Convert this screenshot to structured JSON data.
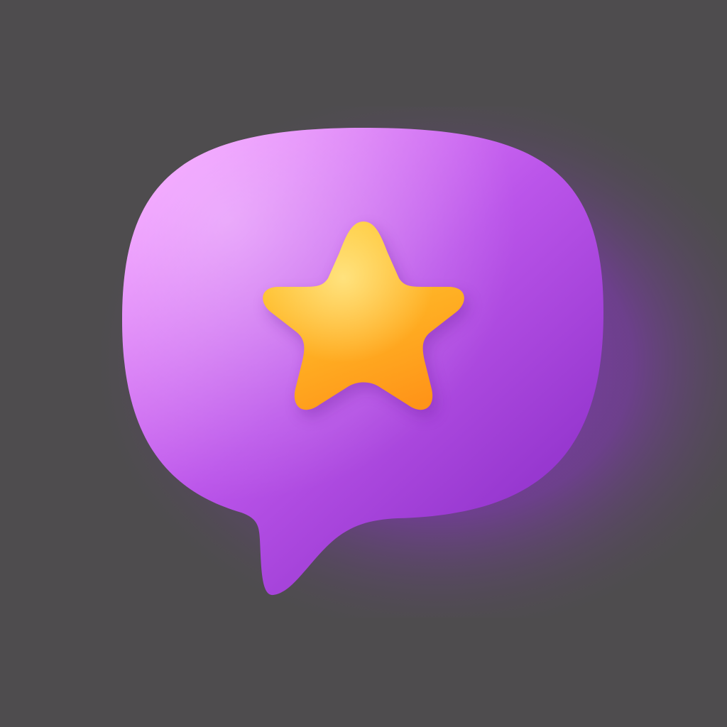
{
  "icon": {
    "name": "speech-bubble-star-icon",
    "bubble_color_light": "#ec88ff",
    "bubble_color_mid": "#b04ee6",
    "bubble_color_dark": "#8a2ec8",
    "star_color_light": "#ffcf3a",
    "star_color_dark": "#ff9a1a",
    "background_color": "#4e4c4e",
    "glow_color": "#8a3fb8"
  }
}
